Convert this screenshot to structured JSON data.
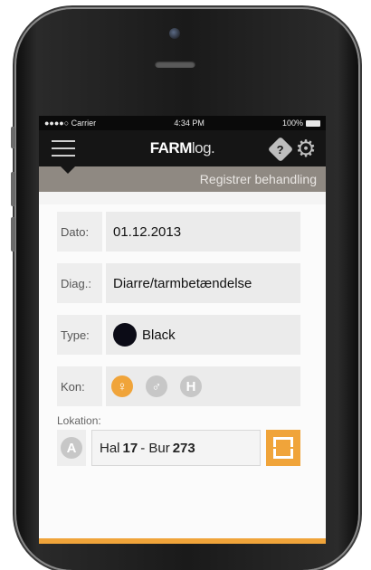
{
  "status": {
    "carrier": "●●●●○ Carrier",
    "time": "4:34 PM",
    "battery": "100%"
  },
  "header": {
    "logo_bold": "FARM",
    "logo_light": "log."
  },
  "subheader": {
    "title": "Registrer behandling"
  },
  "form": {
    "dato_label": "Dato:",
    "dato_value": "01.12.2013",
    "diag_label": "Diag.:",
    "diag_value": "Diarre/tarmbetændelse",
    "type_label": "Type:",
    "type_value": "Black",
    "kon_label": "Kon:",
    "kon_options": [
      "♀",
      "♂",
      "H"
    ],
    "lokation_label": "Lokation:",
    "lokation_badge": "A",
    "lokation_hal_prefix": "Hal",
    "lokation_hal": "17",
    "lokation_sep": "- Bur",
    "lokation_bur": "273"
  },
  "colors": {
    "accent": "#f0a43a",
    "subheader": "#8f8982",
    "navbar": "#151515"
  },
  "icons": {
    "menu": "hamburger-menu-icon",
    "help": "help-diamond-icon",
    "settings": "gear-icon",
    "scan": "scan-frame-icon"
  }
}
